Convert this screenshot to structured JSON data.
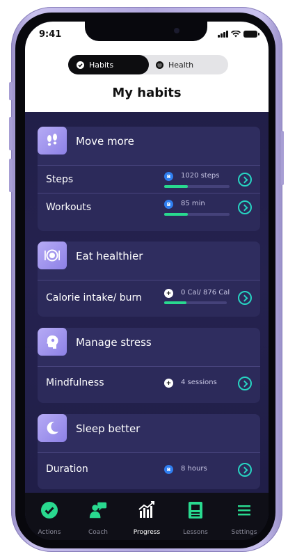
{
  "status_bar": {
    "time": "9:41"
  },
  "toggle": {
    "habits_label": "Habits",
    "health_label": "Health"
  },
  "page_title": "My habits",
  "categories": [
    {
      "title": "Move more",
      "icon": "footprints-icon",
      "rows": [
        {
          "label": "Steps",
          "value": "1020 steps",
          "badge": "bluetooth-icon",
          "progress": 0.36,
          "chevron": "chevron-right-icon"
        },
        {
          "label": "Workouts",
          "value": "85 min",
          "badge": "bluetooth-icon",
          "progress": 0.36,
          "chevron": "chevron-right-icon"
        }
      ]
    },
    {
      "title": "Eat healthier",
      "icon": "plate-icon",
      "rows": [
        {
          "label": "Calorie intake/ burn",
          "value": "0 Cal/ 876 Cal",
          "badge": "plus-icon",
          "progress": 0.36,
          "chevron": "chevron-right-icon"
        }
      ]
    },
    {
      "title": "Manage stress",
      "icon": "head-icon",
      "rows": [
        {
          "label": "Mindfulness",
          "value": "4 sessions",
          "badge": "plus-icon",
          "chevron": "chevron-right-icon"
        }
      ]
    },
    {
      "title": "Sleep better",
      "icon": "moon-icon",
      "rows": [
        {
          "label": "Duration",
          "value": "8 hours",
          "badge": "bluetooth-icon",
          "chevron": "chevron-right-icon"
        }
      ]
    }
  ],
  "tabs": [
    {
      "label": "Actions",
      "icon": "check-circle-icon",
      "active": false
    },
    {
      "label": "Coach",
      "icon": "coach-chat-icon",
      "active": false
    },
    {
      "label": "Progress",
      "icon": "progress-chart-icon",
      "active": true
    },
    {
      "label": "Lessons",
      "icon": "book-icon",
      "active": false
    },
    {
      "label": "Settings",
      "icon": "menu-icon",
      "active": false
    }
  ],
  "colors": {
    "accent_green": "#29d98f",
    "chevron_teal": "#27d4c2",
    "icon_purple": "#9b8ff0",
    "bluetooth_blue": "#2f7ef0"
  }
}
